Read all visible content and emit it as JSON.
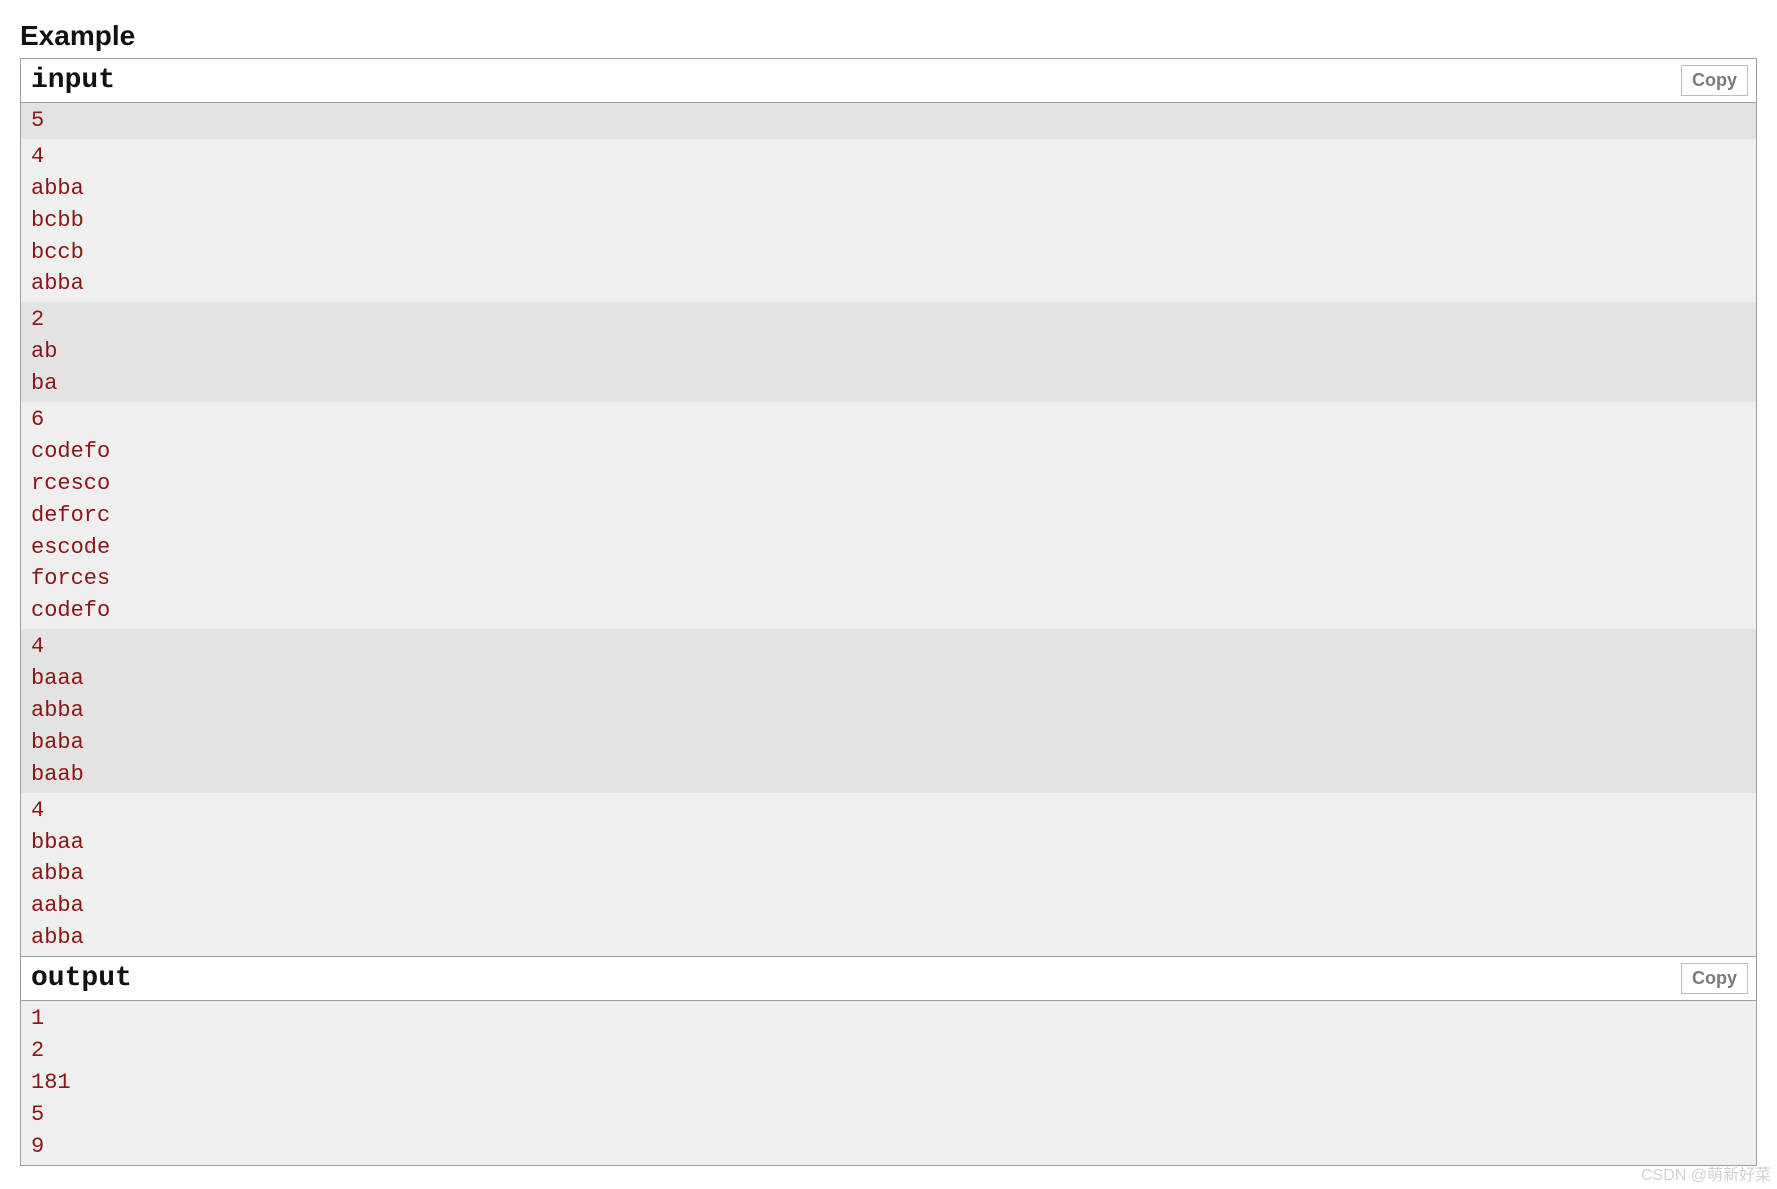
{
  "heading": "Example",
  "copy_label": "Copy",
  "watermark": "CSDN @萌新好菜",
  "sections": [
    {
      "title": "input",
      "groups": [
        {
          "shade": true,
          "lines": [
            "5"
          ]
        },
        {
          "shade": false,
          "lines": [
            "4",
            "abba",
            "bcbb",
            "bccb",
            "abba"
          ]
        },
        {
          "shade": true,
          "lines": [
            "2",
            "ab",
            "ba"
          ]
        },
        {
          "shade": false,
          "lines": [
            "6",
            "codefo",
            "rcesco",
            "deforc",
            "escode",
            "forces",
            "codefo"
          ]
        },
        {
          "shade": true,
          "lines": [
            "4",
            "baaa",
            "abba",
            "baba",
            "baab"
          ]
        },
        {
          "shade": false,
          "lines": [
            "4",
            "bbaa",
            "abba",
            "aaba",
            "abba"
          ]
        }
      ]
    },
    {
      "title": "output",
      "groups": [
        {
          "shade": false,
          "lines": [
            "1",
            "2",
            "181",
            "5",
            "9"
          ]
        }
      ]
    }
  ]
}
